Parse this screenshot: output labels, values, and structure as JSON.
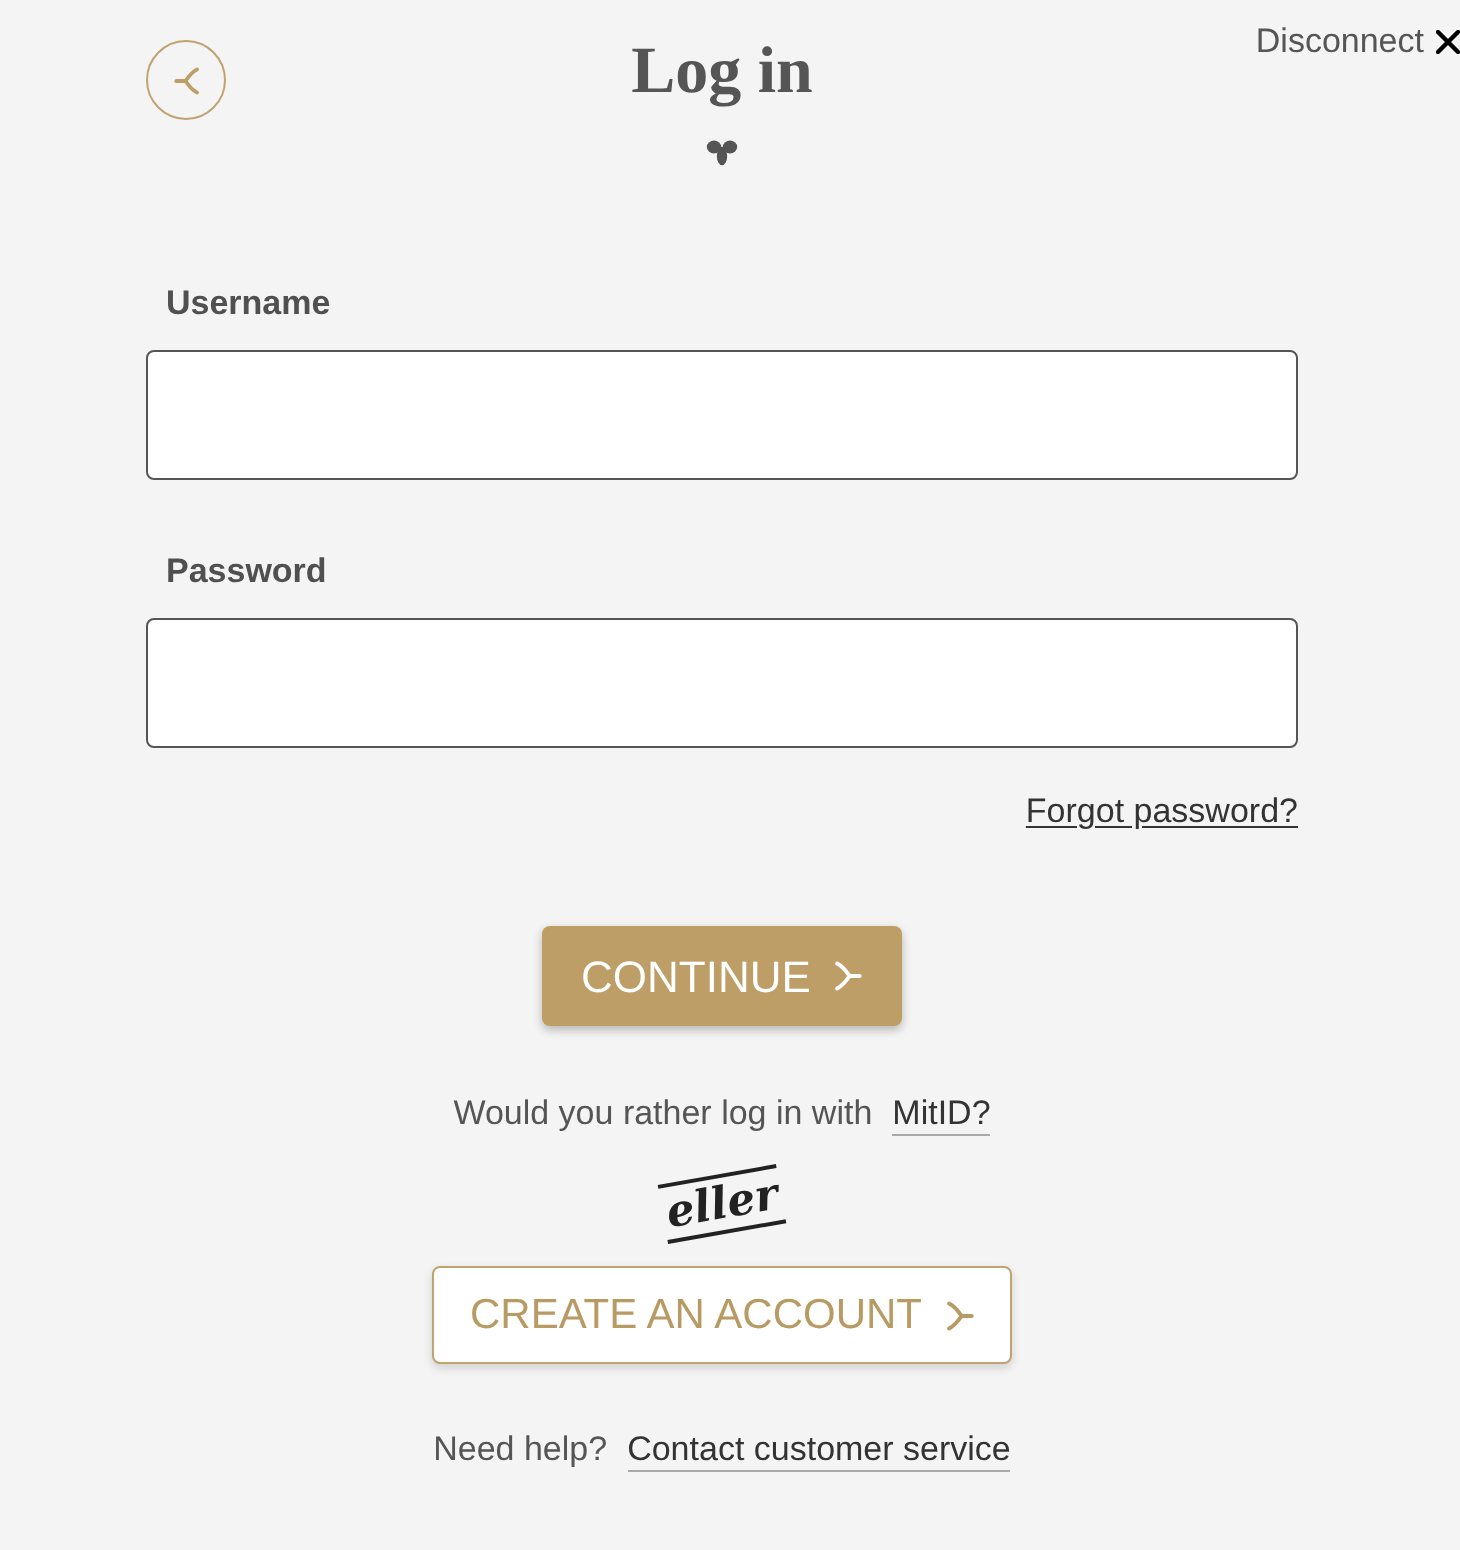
{
  "disconnect": {
    "label": "Disconnect"
  },
  "title": "Log in",
  "fields": [
    {
      "label": "Username"
    },
    {
      "label": "Password"
    }
  ],
  "forgot_password_link": "Forgot password?",
  "continue_button": "CONTINUE",
  "alternative": {
    "text": "Would you rather log in with",
    "link": "MitID?"
  },
  "separator": "eller",
  "create_account_button": "CREATE AN ACCOUNT",
  "help": {
    "text": "Need help?",
    "link": "Contact customer service"
  }
}
